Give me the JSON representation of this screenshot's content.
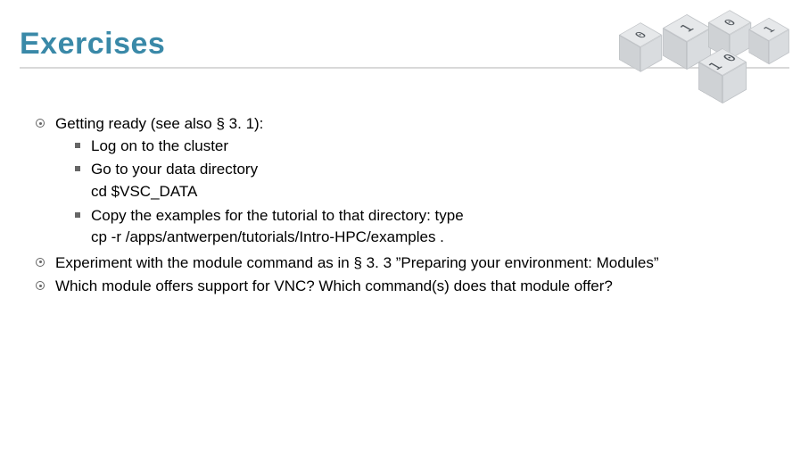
{
  "title": "Exercises",
  "items": [
    {
      "text": "Getting ready (see also § 3. 1):",
      "sub": [
        {
          "text": "Log on to the cluster"
        },
        {
          "text": "Go to your data directory",
          "code": "cd $VSC_DATA"
        },
        {
          "text": "Copy the examples for the tutorial to that directory: type",
          "code": "cp -r /apps/antwerpen/tutorials/Intro-HPC/examples ."
        }
      ]
    },
    {
      "text": "Experiment with the module command as in § 3. 3 ”Preparing your environment: Modules”"
    },
    {
      "text": "Which module offers support for VNC? Which command(s) does that module offer?"
    }
  ],
  "cubes": [
    "0",
    "1",
    "0",
    "1",
    "1 0"
  ]
}
